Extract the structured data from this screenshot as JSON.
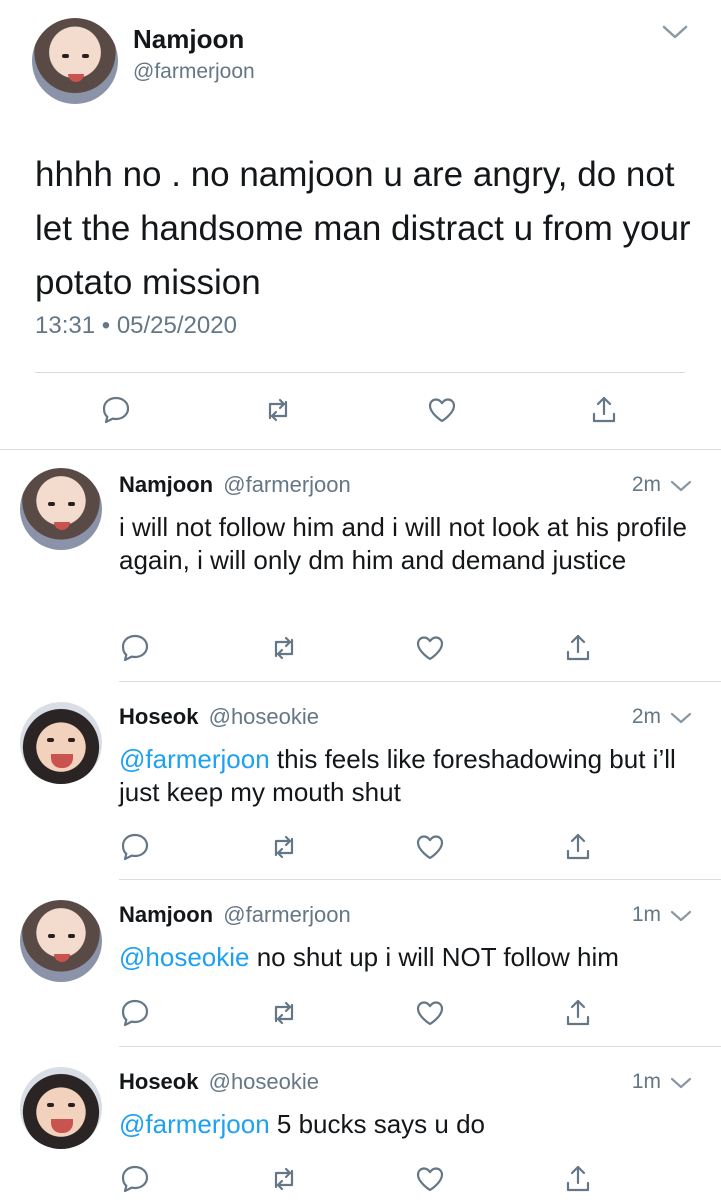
{
  "main_tweet": {
    "display_name": "Namjoon",
    "handle": "@farmerjoon",
    "text": "hhhh no . no namjoon u are angry, do not let the handsome man distract u from your potato mission",
    "time": "13:31",
    "separator": "•",
    "date": "05/25/2020"
  },
  "replies": [
    {
      "display_name": "Namjoon",
      "handle": "@farmerjoon",
      "time": "2m",
      "mention": "",
      "text": "i will not follow him and i will not look at his profile again, i will only dm him and demand justice"
    },
    {
      "display_name": "Hoseok",
      "handle": "@hoseokie",
      "time": "2m",
      "mention": "@farmerjoon",
      "text": " this feels like foreshadowing but i’ll just keep my mouth shut"
    },
    {
      "display_name": "Namjoon",
      "handle": "@farmerjoon",
      "time": "1m",
      "mention": "@hoseokie",
      "text": " no shut up i will NOT follow him"
    },
    {
      "display_name": "Hoseok",
      "handle": "@hoseokie",
      "time": "1m",
      "mention": "@farmerjoon",
      "text": " 5 bucks says u do"
    }
  ],
  "icons": {
    "reply": "reply-icon",
    "retweet": "retweet-icon",
    "like": "like-icon",
    "share": "share-icon",
    "more": "chevron-down-icon"
  },
  "colors": {
    "text": "#14171a",
    "secondary": "#657786",
    "mention": "#1da1f2",
    "icon": "#657786",
    "divider": "#d8dee3"
  }
}
